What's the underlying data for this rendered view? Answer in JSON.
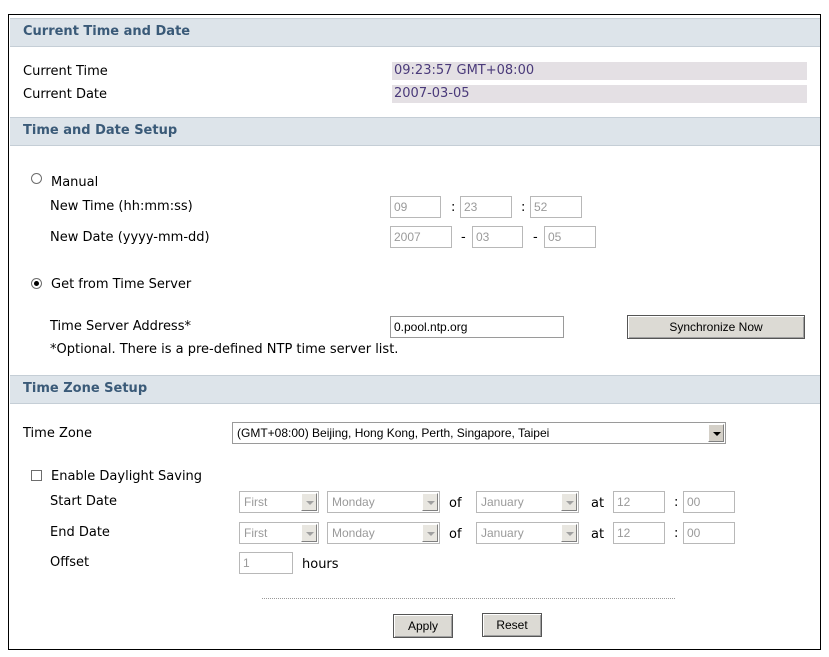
{
  "sections": {
    "current_title": "Current Time and Date",
    "setup_title": "Time and Date Setup",
    "zone_title": "Time Zone Setup"
  },
  "current": {
    "time_label": "Current Time",
    "time_value": "09:23:57 GMT+08:00",
    "date_label": "Current Date",
    "date_value": "2007-03-05"
  },
  "manual": {
    "label": "Manual",
    "selected": false,
    "new_time_label": "New Time (hh:mm:ss)",
    "hh": "09",
    "mm": "23",
    "ss": "52",
    "new_date_label": "New Date (yyyy-mm-dd)",
    "yyyy": "2007",
    "month": "03",
    "day": "05",
    "time_sep": ":",
    "date_sep": "-"
  },
  "server": {
    "label": "Get from Time Server",
    "selected": true,
    "address_label": "Time Server Address*",
    "address_value": "0.pool.ntp.org",
    "sync_button": "Synchronize Now",
    "note": "*Optional. There is a pre-defined NTP time server list."
  },
  "zone": {
    "label": "Time Zone",
    "selected": "(GMT+08:00) Beijing, Hong Kong, Perth, Singapore, Taipei"
  },
  "dst": {
    "label": "Enable Daylight Saving",
    "checked": false,
    "start_label": "Start Date",
    "end_label": "End Date",
    "offset_label": "Offset",
    "week": "First",
    "weekday": "Monday",
    "of": "of",
    "month": "January",
    "at": "at",
    "hour": "12",
    "minute": "00",
    "colon": ":",
    "offset_value": "1",
    "hours": "hours"
  },
  "actions": {
    "apply": "Apply",
    "reset": "Reset"
  }
}
